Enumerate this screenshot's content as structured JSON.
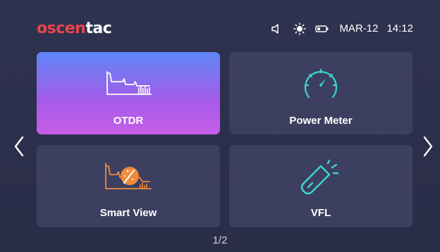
{
  "header": {
    "logo_part1": "oscen",
    "logo_part2": "tac",
    "brand_color": "#e9444a",
    "date": "MAR-12",
    "time": "14:12",
    "status_icons": [
      "speaker-icon",
      "brightness-icon",
      "battery-icon"
    ]
  },
  "tiles": [
    {
      "label": "OTDR",
      "icon": "otdr-trace-icon",
      "selected": true
    },
    {
      "label": "Power Meter",
      "icon": "gauge-icon",
      "selected": false
    },
    {
      "label": "Smart View",
      "icon": "smart-view-icon",
      "selected": false
    },
    {
      "label": "VFL",
      "icon": "flashlight-icon",
      "selected": false
    }
  ],
  "pager": {
    "text": "1/2",
    "current": 1,
    "total": 2
  },
  "colors": {
    "selected_gradient_top": "#5f86f7",
    "selected_gradient_bottom": "#c55ee8",
    "tile_bg": "#3c3f5f",
    "icon_cyan": "#3ad7d4",
    "icon_orange": "#f08a3a"
  }
}
